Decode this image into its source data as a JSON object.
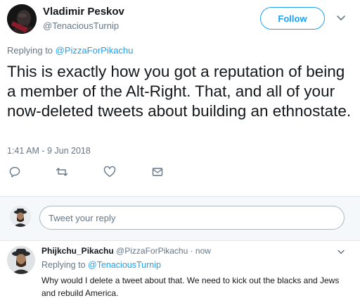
{
  "tweet": {
    "author_name": "Vladimir Peskov",
    "author_handle": "@TenaciousTurnip",
    "follow_label": "Follow",
    "replying_prefix": "Replying to ",
    "replying_handle": "@PizzaForPikachu",
    "text": "This is exactly how you got a reputation of being a member of the Alt-Right.  That, and all of your now-deleted tweets about building an ethnostate.",
    "timestamp": "1:41 AM - 9 Jun 2018",
    "icons": [
      "reply-icon",
      "retweet-icon",
      "like-icon",
      "direct-message-icon"
    ]
  },
  "reply_box": {
    "placeholder": "Tweet your reply"
  },
  "reply": {
    "author_name": "Phijkchu_Pikachu",
    "meta": " @PizzaForPikachu · now",
    "replying_prefix": "Replying to ",
    "replying_handle": "@TenaciousTurnip",
    "text": "Why would I delete a tweet about that. We need to kick out the blacks and Jews and rebuild America."
  },
  "colors": {
    "accent": "#1da1f2",
    "muted": "#657786",
    "text": "#14171a",
    "divider": "#e1e8ed"
  }
}
